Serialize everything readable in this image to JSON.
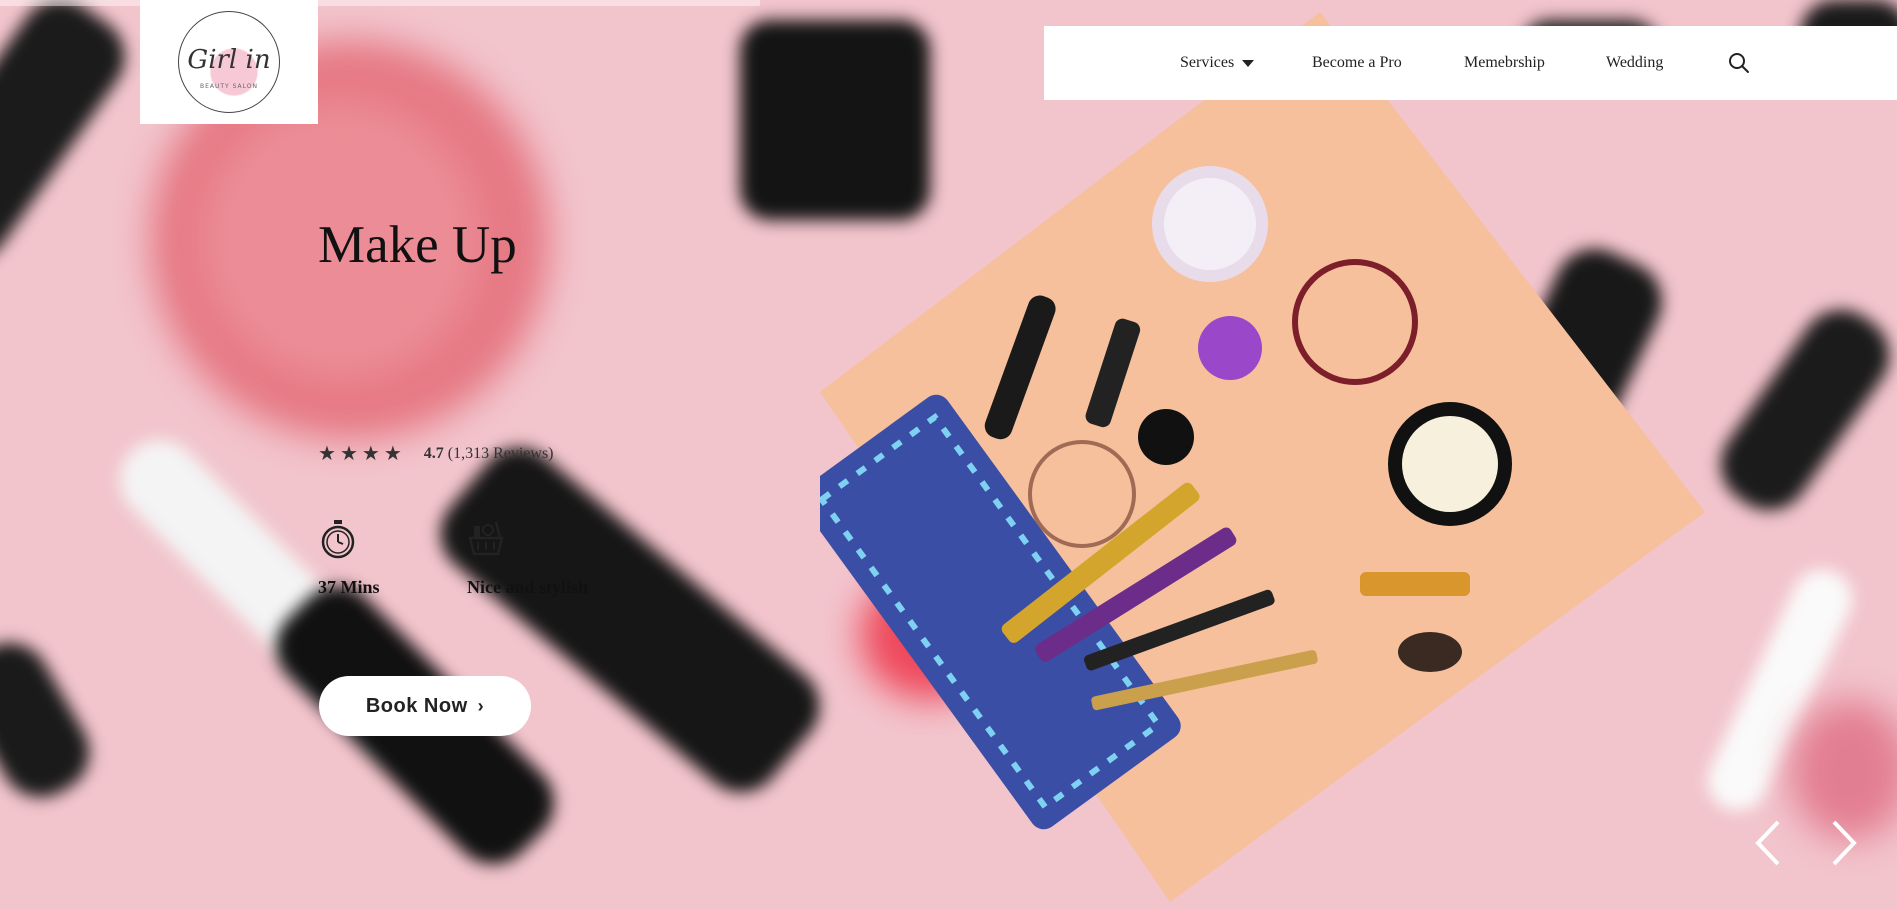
{
  "logo": {
    "main": "Girl in",
    "sub": "BEAUTY SALON"
  },
  "nav": {
    "items": [
      {
        "label": "Services",
        "has_dropdown": true
      },
      {
        "label": "Become a Pro"
      },
      {
        "label": "Memebrship"
      },
      {
        "label": "Wedding"
      }
    ],
    "search_icon": "search-icon"
  },
  "hero": {
    "title": "Make Up",
    "rating": {
      "stars": 4,
      "value": "4.7",
      "reviews": "(1,313 Reviews)"
    },
    "features": [
      {
        "icon": "stopwatch-icon",
        "label": "37 Mins"
      },
      {
        "icon": "makeup-basket-icon",
        "label": "Nice and stylish"
      }
    ],
    "cta": {
      "label": "Book Now"
    }
  },
  "slider": {
    "prev_icon": "chevron-left-icon",
    "next_icon": "chevron-right-icon"
  },
  "colors": {
    "background": "#f2c4cc",
    "diamond": "#f6c09c",
    "text": "#111111"
  }
}
